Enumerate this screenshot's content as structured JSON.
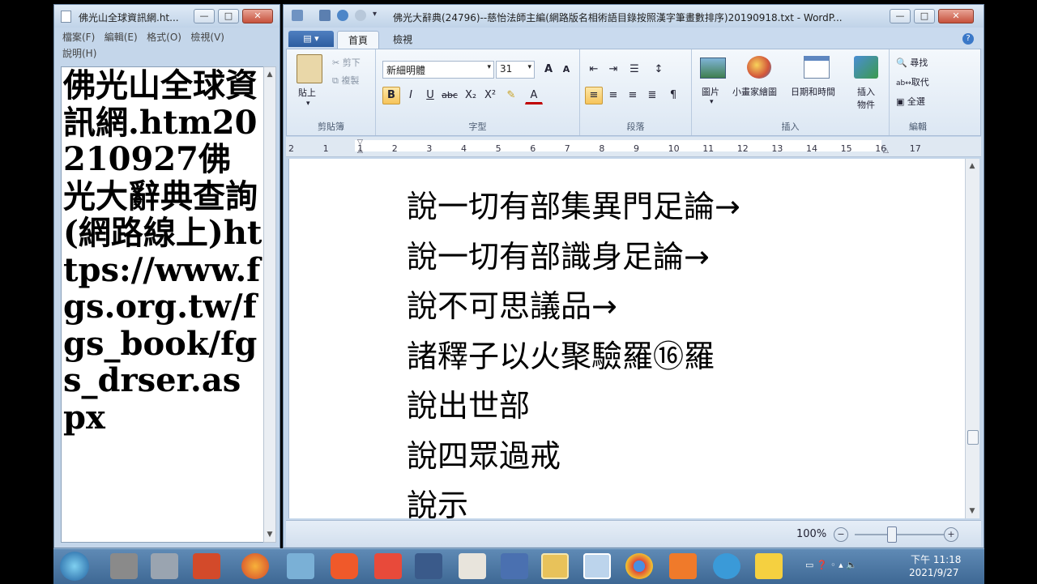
{
  "notepad": {
    "title": "佛光山全球資訊網.ht...",
    "menu_row1": [
      "檔案(F)",
      "編輯(E)",
      "格式(O)",
      "檢視(V)"
    ],
    "menu_row2": [
      "說明(H)"
    ],
    "content": "佛光山全球資訊網.htm20210927佛光大辭典查詢(網路線上)https://www.fgs.org.tw/fgs_book/fgs_drser.aspx"
  },
  "wordpad": {
    "title": "佛光大辭典(24796)--慈怡法師主編(網路版名相術語目錄按照漢字筆畫數排序)20190918.txt - WordP...",
    "tabs": [
      "首頁",
      "檢視"
    ],
    "clipboard": {
      "paste": "貼上",
      "cut": "剪下",
      "copy": "複製",
      "label": "剪貼簿"
    },
    "font": {
      "family": "新細明體",
      "size": "31",
      "label": "字型"
    },
    "paragraph": {
      "label": "段落"
    },
    "insert": {
      "picture": "圖片",
      "paint": "小畫家繪圖",
      "datetime": "日期和時間",
      "object_line1": "插入",
      "object_line2": "物件",
      "label": "插入"
    },
    "editing": {
      "find": "尋找",
      "replace": "取代",
      "select_all": "全選",
      "label": "編輯"
    },
    "ruler_ticks": [
      "2",
      "1",
      "1",
      "2",
      "3",
      "4",
      "5",
      "6",
      "7",
      "8",
      "9",
      "10",
      "11",
      "12",
      "13",
      "14",
      "15",
      "16",
      "17"
    ],
    "document_lines": [
      "說一切有部集異門足論→",
      "說一切有部識身足論→",
      "說不可思議品→",
      "諸釋子以火聚驗羅⑯羅",
      "說出世部",
      "說四眾過戒",
      "說示"
    ],
    "zoom": "100%"
  },
  "taskbar": {
    "time": "下午 11:18",
    "date": "2021/9/27"
  },
  "colors": {
    "titlebar": "#c4d6ea",
    "taskbar": "#4e79a6",
    "highlight": "#f6c45a"
  }
}
